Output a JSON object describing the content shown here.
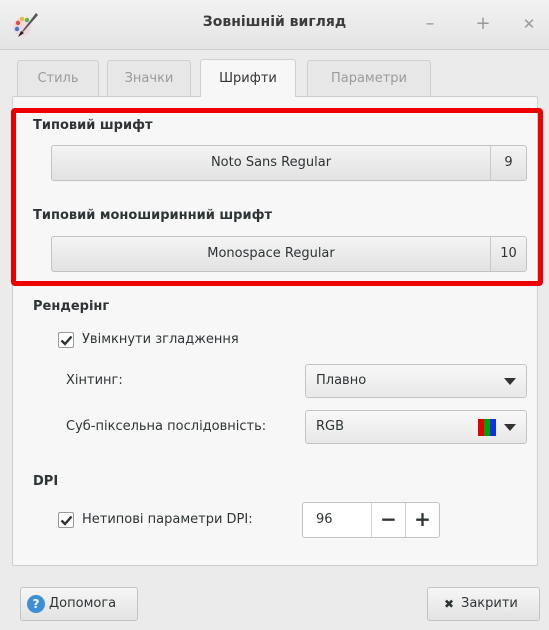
{
  "window": {
    "title": "Зовнішній вигляд",
    "controls": {
      "minimize": "–",
      "maximize": "+",
      "close": "✕"
    }
  },
  "tabs": [
    {
      "label": "Стиль",
      "active": false
    },
    {
      "label": "Значки",
      "active": false
    },
    {
      "label": "Шрифти",
      "active": true
    },
    {
      "label": "Параметри",
      "active": false
    }
  ],
  "fonts": {
    "default_title": "Типовий шрифт",
    "default_font": "Noto Sans Regular",
    "default_size": "9",
    "mono_title": "Типовий моноширинний шрифт",
    "mono_font": "Monospace Regular",
    "mono_size": "10"
  },
  "rendering": {
    "title": "Рендерінг",
    "antialias_label": "Увімкнути згладження",
    "antialias_checked": true,
    "hinting_label": "Хінтинг:",
    "hinting_value": "Плавно",
    "subpixel_label": "Суб-піксельна послідовність:",
    "subpixel_value": "RGB"
  },
  "dpi": {
    "title": "DPI",
    "custom_label": "Нетипові параметри DPI:",
    "custom_checked": true,
    "value": "96",
    "minus": "−",
    "plus": "+"
  },
  "buttons": {
    "help": "Допомога",
    "help_icon": "?",
    "close": "Закрити",
    "close_icon": "✖"
  },
  "colors": {
    "highlight": "#ee0000",
    "subpixel_r": "#e00000",
    "subpixel_g": "#00a000",
    "subpixel_b": "#1030e0"
  }
}
